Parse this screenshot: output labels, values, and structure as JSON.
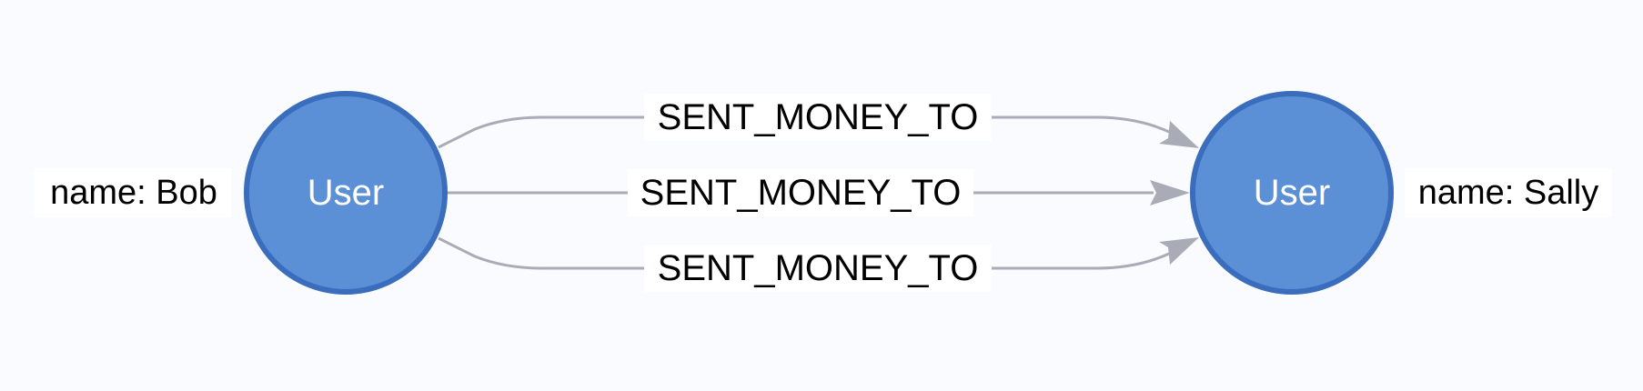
{
  "graph": {
    "nodes": [
      {
        "caption": "User",
        "property": "name: Bob",
        "fill": "#5b8fd6",
        "stroke": "#3b6dbd"
      },
      {
        "caption": "User",
        "property": "name: Sally",
        "fill": "#5b8fd6",
        "stroke": "#3b6dbd"
      }
    ],
    "relationships": [
      {
        "type": "SENT_MONEY_TO",
        "from": 0,
        "to": 1
      },
      {
        "type": "SENT_MONEY_TO",
        "from": 0,
        "to": 1
      },
      {
        "type": "SENT_MONEY_TO",
        "from": 0,
        "to": 1
      }
    ],
    "edge_color": "#a9acb6"
  }
}
